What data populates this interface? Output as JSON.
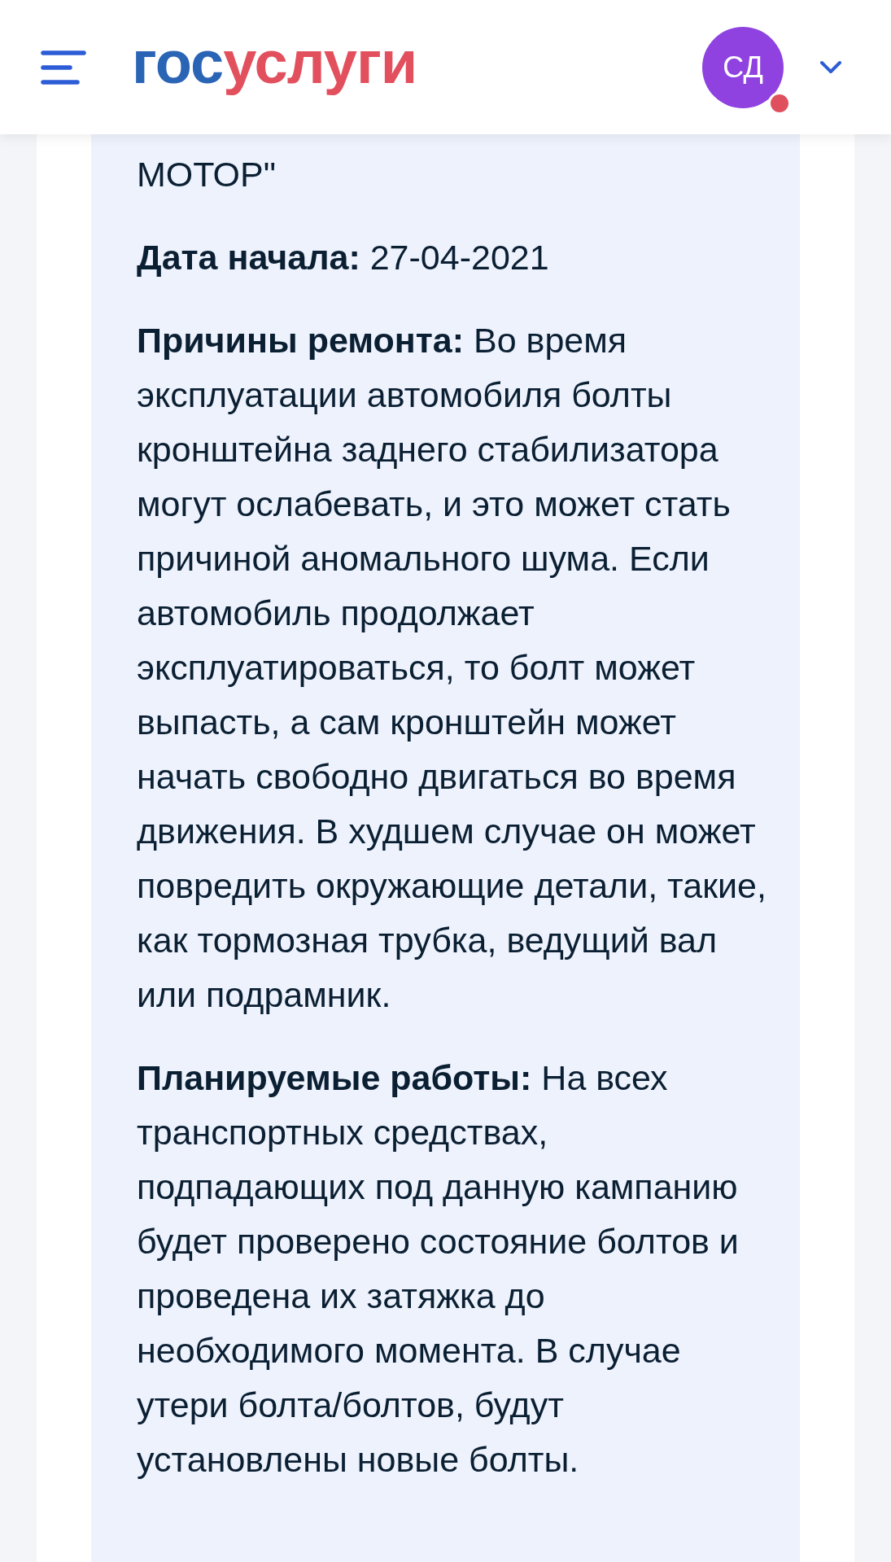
{
  "header": {
    "logo": [
      "гос",
      "услуги"
    ],
    "avatar": {
      "initials": "СД",
      "notification": true
    }
  },
  "recall_details": [
    {
      "text": "МОТОР\""
    },
    {
      "text": "**Дата начала:** 27-04-2021"
    },
    {
      "text": "**Причины ремонта:** Во время эксплуатации автомобиля болты кронштейна заднего стабилизатора могут ослабевать, и это может стать причиной аномального шума. Если автомобиль продолжает эксплуатироваться, то болт может выпасть, а сам кронштейн может начать свободно двигаться во время движения. В худшем случае он может повредить окружающие детали, такие, как тормозная трубка, ведущий вал или подрамник."
    },
    {
      "text": "**Планируемые работы:** На всех транспортных средствах, подпадающих под данную кампанию будет проверено состояние болтов и проведена их затяжка до необходимого момента. В случае утери болта/болтов, будут установлены новые болты."
    }
  ]
}
